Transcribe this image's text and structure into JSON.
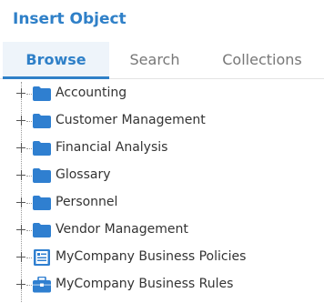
{
  "dialog": {
    "title": "Insert Object"
  },
  "tabs": [
    {
      "label": "Browse",
      "active": true
    },
    {
      "label": "Search",
      "active": false
    },
    {
      "label": "Collections",
      "active": false
    }
  ],
  "tree": {
    "items": [
      {
        "label": "Accounting",
        "icon": "folder-icon"
      },
      {
        "label": "Customer Management",
        "icon": "folder-icon"
      },
      {
        "label": "Financial Analysis",
        "icon": "folder-icon"
      },
      {
        "label": "Glossary",
        "icon": "folder-icon"
      },
      {
        "label": "Personnel",
        "icon": "folder-icon"
      },
      {
        "label": "Vendor Management",
        "icon": "folder-icon"
      },
      {
        "label": "MyCompany Business Policies",
        "icon": "policy-book-icon"
      },
      {
        "label": "MyCompany Business Rules",
        "icon": "briefcase-icon"
      }
    ]
  },
  "colors": {
    "accent": "#2f80c8",
    "folder": "#2f7fd0",
    "active_tab_bg": "#eef4fa",
    "text": "#333333",
    "inactive_tab_text": "#777777"
  }
}
